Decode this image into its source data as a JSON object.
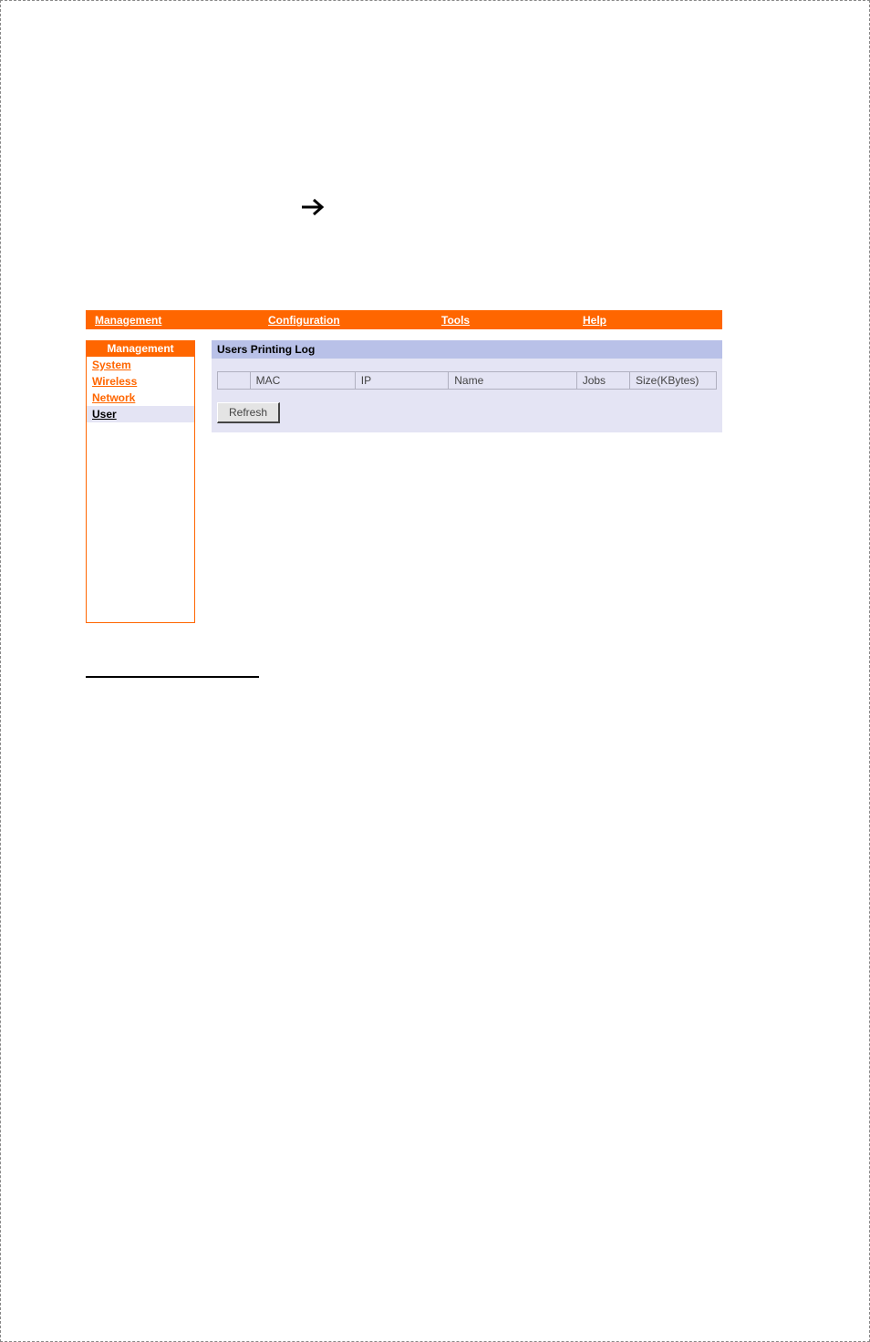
{
  "topnav": {
    "items": [
      "Management",
      "Configuration",
      "Tools",
      "Help"
    ]
  },
  "sidebar": {
    "header": "Management",
    "items": [
      {
        "label": "System",
        "active": false
      },
      {
        "label": "Wireless",
        "active": false
      },
      {
        "label": "Network",
        "active": false
      },
      {
        "label": "User",
        "active": true
      }
    ]
  },
  "panel": {
    "title": "Users Printing Log",
    "columns": [
      "",
      "MAC",
      "IP",
      "Name",
      "Jobs",
      "Size(KBytes)"
    ],
    "refresh_label": "Refresh"
  }
}
